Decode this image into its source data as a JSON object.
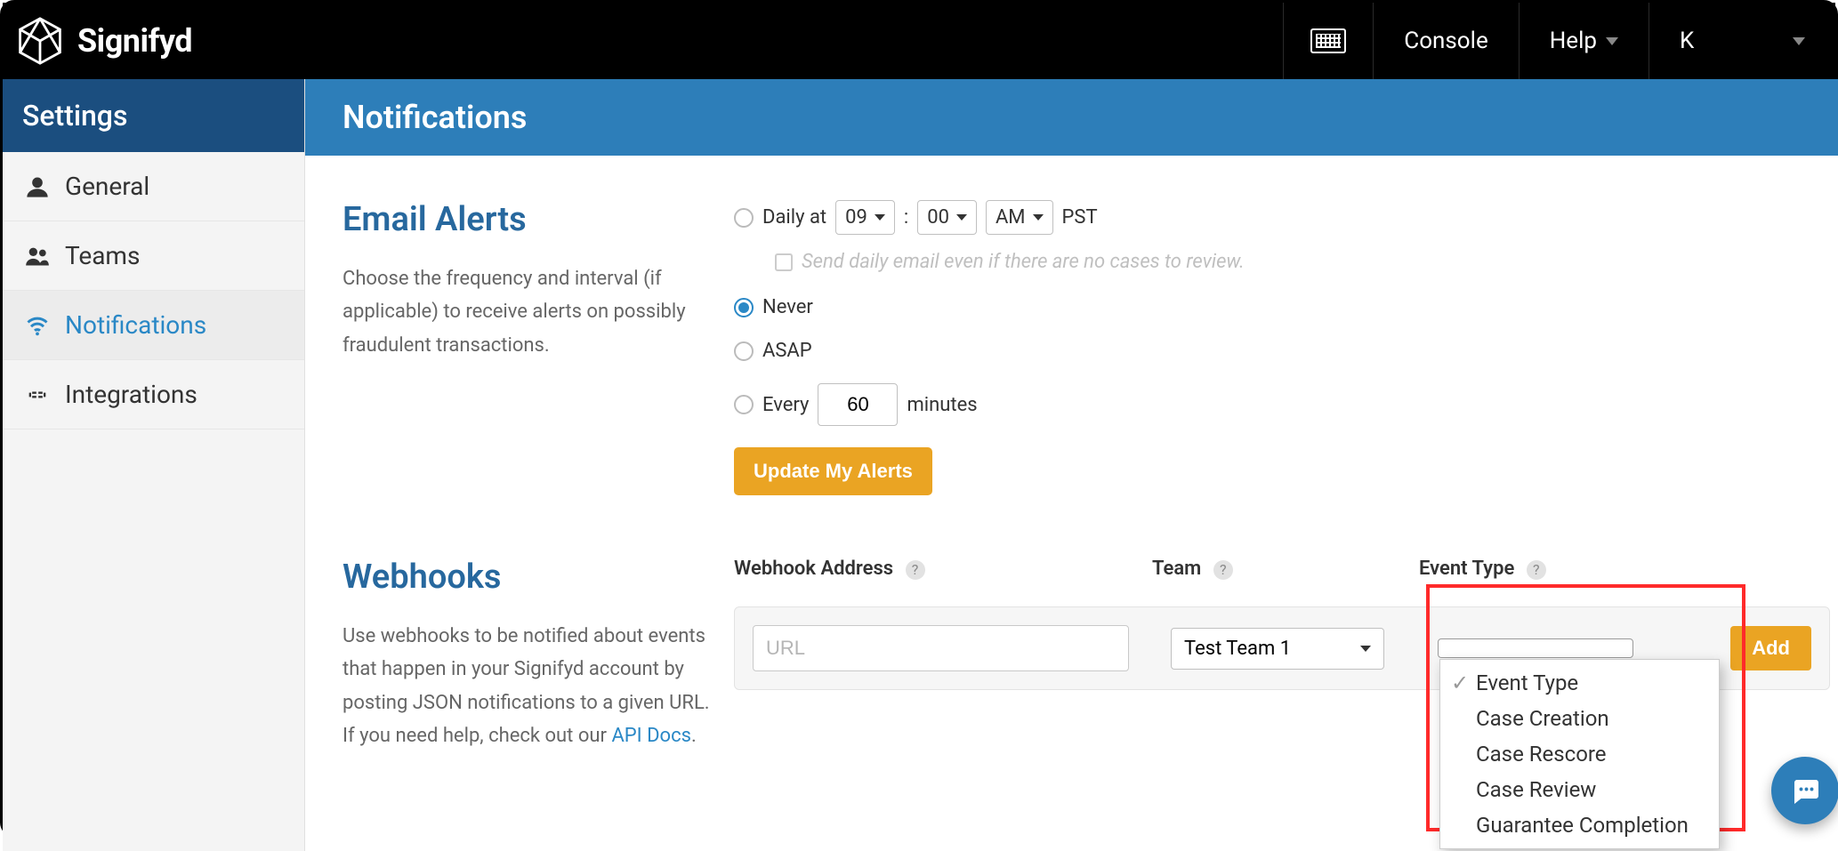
{
  "brand": {
    "name": "Signifyd"
  },
  "topnav": {
    "console": "Console",
    "help": "Help",
    "user_initial": "K"
  },
  "sidebar": {
    "title": "Settings",
    "items": [
      {
        "label": "General",
        "icon": "user-icon"
      },
      {
        "label": "Teams",
        "icon": "users-icon"
      },
      {
        "label": "Notifications",
        "icon": "wifi-icon"
      },
      {
        "label": "Integrations",
        "icon": "plug-icon"
      }
    ],
    "active_index": 2
  },
  "page": {
    "title": "Notifications"
  },
  "email_alerts": {
    "title": "Email Alerts",
    "description": "Choose the frequency and interval (if applicable) to receive alerts on possibly fraudulent transactions.",
    "daily_label": "Daily at",
    "hour": "09",
    "minute": "00",
    "ampm": "AM",
    "timezone": "PST",
    "send_empty_label": "Send daily email even if there are no cases to review.",
    "never_label": "Never",
    "asap_label": "ASAP",
    "every_label": "Every",
    "every_minutes": "60",
    "minutes_label": "minutes",
    "update_button": "Update My Alerts",
    "selected": "never"
  },
  "webhooks": {
    "title": "Webhooks",
    "description_prefix": "Use webhooks to be notified about events that happen in your Signifyd account by posting JSON notifications to a given URL. If you need help, check out our ",
    "api_docs_text": "API Docs",
    "description_suffix": ".",
    "col_address": "Webhook Address",
    "col_team": "Team",
    "col_event": "Event Type",
    "url_placeholder": "URL",
    "team_selected": "Test Team 1",
    "event_options": [
      "Event Type",
      "Case Creation",
      "Case Rescore",
      "Case Review",
      "Guarantee Completion"
    ],
    "event_selected_index": 0,
    "add_button": "Add"
  }
}
